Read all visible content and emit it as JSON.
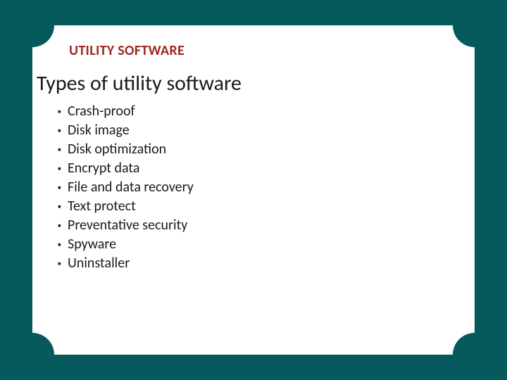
{
  "header": {
    "section": "UTILITY SOFTWARE"
  },
  "title": "Types of utility software",
  "bullet_char": "▪",
  "items": [
    {
      "text": "Crash-proof"
    },
    {
      "text": "Disk image"
    },
    {
      "text": "Disk optimization"
    },
    {
      "text": "Encrypt data"
    },
    {
      "text": "File and data recovery"
    },
    {
      "text": "Text protect"
    },
    {
      "text": "Preventative security"
    },
    {
      "text": "Spyware"
    },
    {
      "text": "Uninstaller"
    }
  ]
}
